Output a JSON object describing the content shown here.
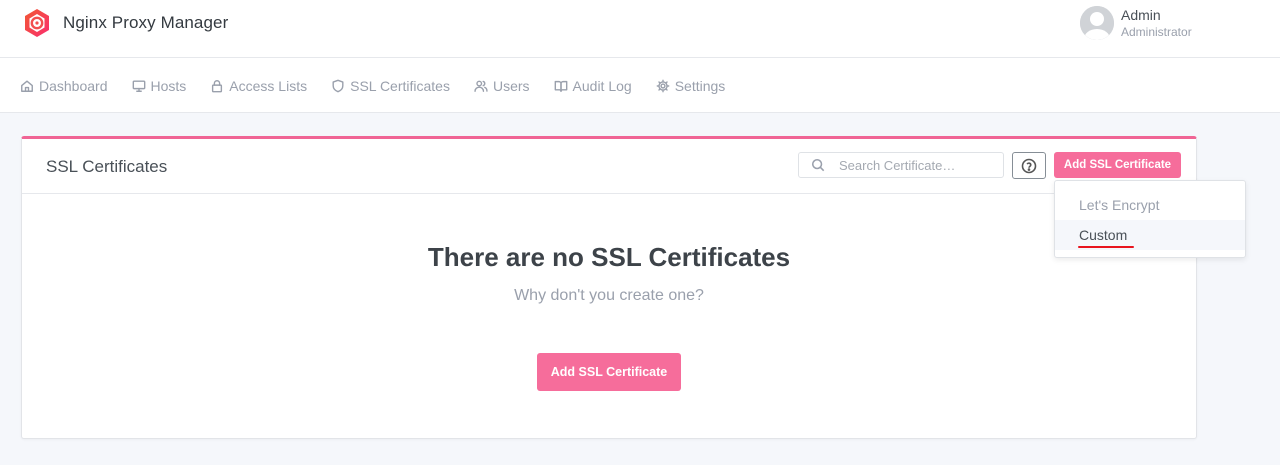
{
  "header": {
    "app_title": "Nginx Proxy Manager",
    "user_name": "Admin",
    "user_role": "Administrator"
  },
  "nav": {
    "items": [
      {
        "label": "Dashboard",
        "icon": "home-icon"
      },
      {
        "label": "Hosts",
        "icon": "monitor-icon"
      },
      {
        "label": "Access Lists",
        "icon": "lock-icon"
      },
      {
        "label": "SSL Certificates",
        "icon": "shield-icon"
      },
      {
        "label": "Users",
        "icon": "users-icon"
      },
      {
        "label": "Audit Log",
        "icon": "book-icon"
      },
      {
        "label": "Settings",
        "icon": "gear-icon"
      }
    ]
  },
  "card": {
    "title": "SSL Certificates",
    "search_placeholder": "Search Certificate…",
    "add_button_label": "Add SSL Certificate",
    "empty_title": "There are no SSL Certificates",
    "empty_subtitle": "Why don't you create one?",
    "empty_button_label": "Add SSL Certificate"
  },
  "dropdown": {
    "items": [
      "Let's Encrypt",
      "Custom"
    ],
    "highlighted": "Custom"
  },
  "colors": {
    "accent": "#f66d9b",
    "card_border_top": "#f06595",
    "annotation_underline": "#e8141e"
  }
}
